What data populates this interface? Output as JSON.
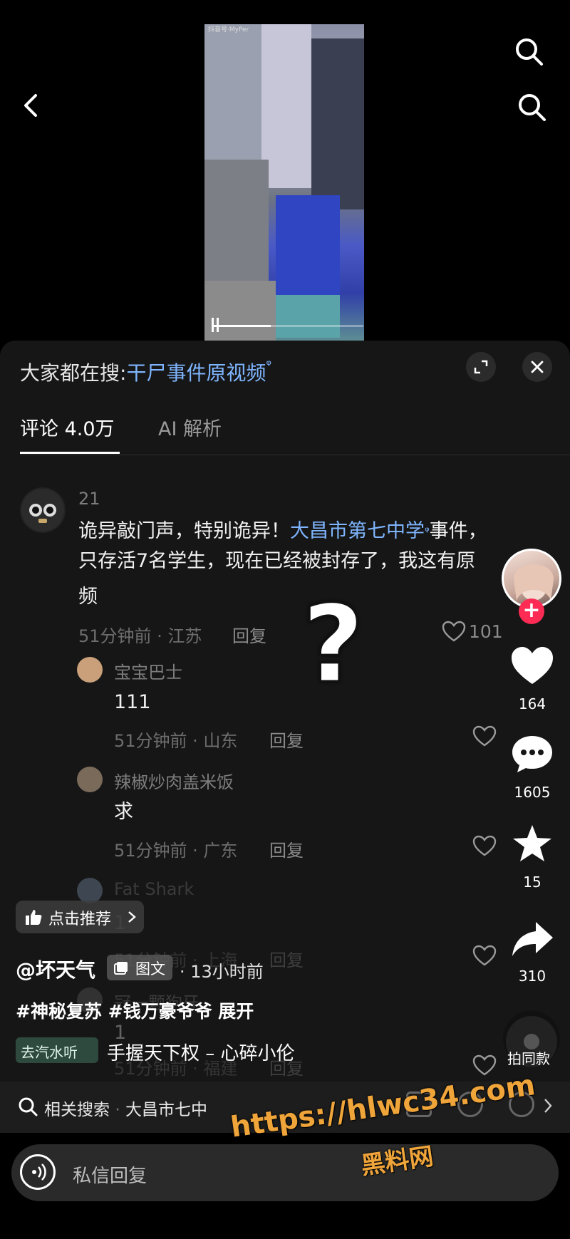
{
  "video": {
    "watermark": "抖音号·MyPer"
  },
  "search_banner": {
    "prefix": "大家都在搜:",
    "query": "干尸事件原视频"
  },
  "tabs": [
    {
      "label": "评论 4.0万",
      "active": true
    },
    {
      "label": "AI 解析",
      "active": false
    }
  ],
  "comments": {
    "main": {
      "user": "21",
      "text_a": "诡异敲门声，特别诡异！",
      "link": "大昌市第七中学",
      "text_b": "事件，",
      "line2": "只存活7名学生，现在已经被封存了，我这有原",
      "line3": "频",
      "meta": "51分钟前 · 江苏",
      "reply": "回复",
      "likes": "101"
    },
    "replies": [
      {
        "user": "宝宝巴士",
        "text": "111",
        "meta": "51分钟前 · 山东",
        "reply": "回复"
      },
      {
        "user": "辣椒炒肉盖米饭",
        "text": "求",
        "meta": "51分钟前 · 广东",
        "reply": "回复"
      },
      {
        "user": "Fat Shark",
        "text": "1",
        "meta": "51分钟前 · 上海",
        "reply": "回复"
      },
      {
        "user": "冠一颗狗牙",
        "text": "1",
        "meta": "51分钟前 · 福建",
        "reply": "回复"
      }
    ]
  },
  "overlay": {
    "question_mark": "?"
  },
  "rail": {
    "likes": "164",
    "comments": "1605",
    "favorites": "15",
    "shares": "310",
    "same_label": "拍同款"
  },
  "post": {
    "recommend": "点击推荐",
    "author": "@坏天气",
    "tag": "图文",
    "time": "· 13小时前",
    "hashtags": "#神秘复苏 #钱万豪爷爷 展开",
    "music_source": "去汽水听",
    "music_title": "手握天下权 – 心碎小伦"
  },
  "related": {
    "label": "相关搜索",
    "query": "大昌市七中"
  },
  "dm": {
    "placeholder": "私信回复"
  },
  "watermark": {
    "url": "https://hlwc34.com",
    "site": "黑料网"
  },
  "colors": {
    "link": "#7fb5ff",
    "follow": "#fe2c55",
    "watermark": "#f0a53a"
  }
}
